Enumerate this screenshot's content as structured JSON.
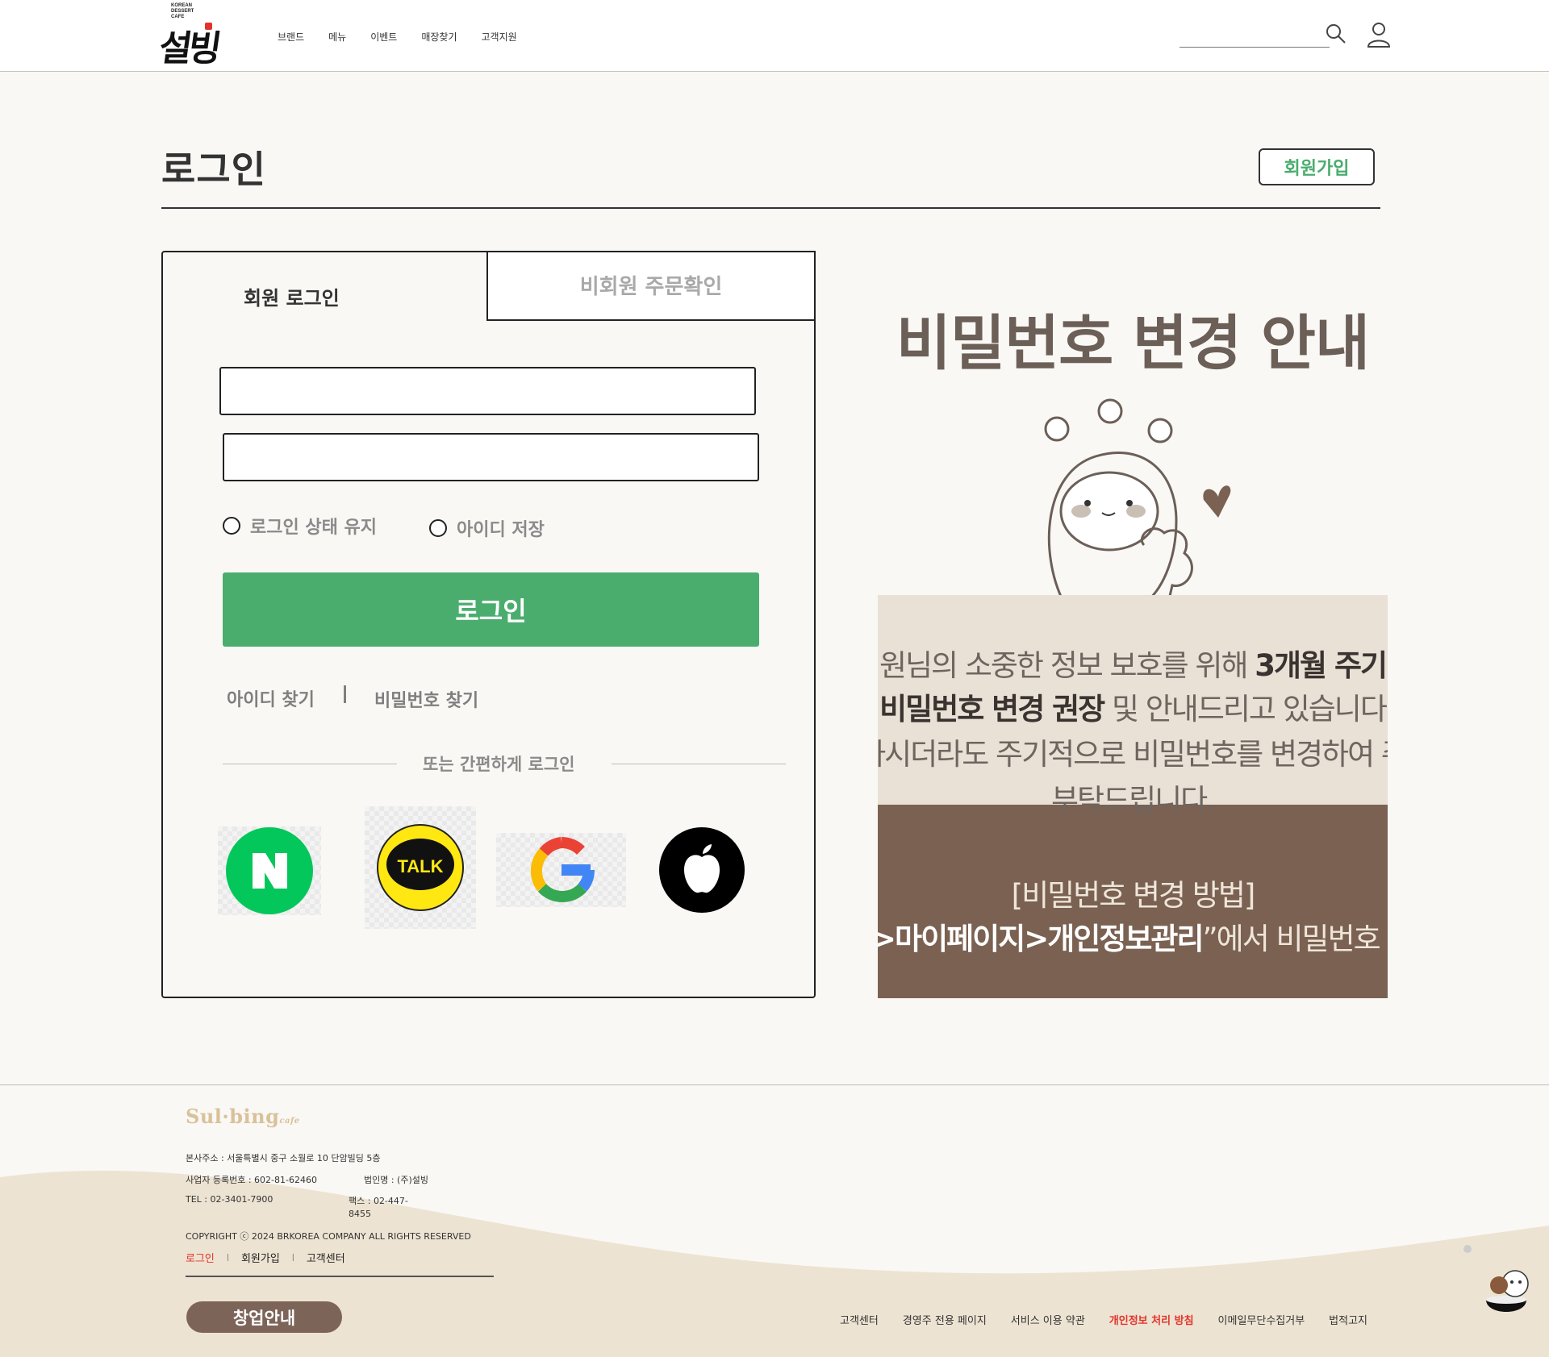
{
  "header": {
    "logo_small": "KOREAN DESSERT CAFE",
    "logo_main": "설빙",
    "nav": [
      "브랜드",
      "메뉴",
      "이벤트",
      "매장찾기",
      "고객지원"
    ],
    "icons": [
      "search-icon",
      "user-icon"
    ]
  },
  "page": {
    "title": "로그인",
    "signup_label": "회원가입"
  },
  "login": {
    "tab_member": "회원 로그인",
    "tab_guest": "비회원 주문확인",
    "id_value": "",
    "pw_value": "",
    "keep_login": "로그인 상태 유지",
    "save_id": "아이디 저장",
    "login_button": "로그인",
    "find_id": "아이디 찾기",
    "find_pw": "비밀번호 찾기",
    "or_text": "또는 간편하게 로그인",
    "social": [
      {
        "name": "naver",
        "glyph": "N",
        "color": "#03c75a"
      },
      {
        "name": "kakao",
        "glyph": "TALK",
        "color": "#ffe812"
      },
      {
        "name": "google",
        "glyph": "G",
        "color": "#4285f4"
      },
      {
        "name": "apple",
        "glyph": "apple-icon",
        "color": "#000000"
      }
    ]
  },
  "notice": {
    "title": "비밀번호 변경 안내",
    "line1_pre": "원님의 소중한 정보 보호를 위해 ",
    "line1_bold": "3개월 주기",
    "line2_bold": "비밀번호 변경 권장",
    "line2_post": " 및 안내드리고 있습니다",
    "line3": "하시더라도 주기적으로 비밀번호를 변경하여 주",
    "line4": "부탁드립니다.",
    "method_title": "[비밀번호 변경 방법]",
    "method_bold": "인>마이페이지>개인정보관리",
    "method_post": "”에서 비밀번호 변경"
  },
  "footer": {
    "logo": "Sul·bing",
    "logo_sub": "cafe",
    "address": "본사주소 : 서울특별시 중구 소월로 10 단암빌딩 5층",
    "biz_no": "사업자 등록번호 : 602-81-62460",
    "corp": "법인명 : (주)설빙",
    "tel": "TEL : 02-3401-7900",
    "fax_line1": "팩스 : 02-447-",
    "fax_line2": "8455",
    "copyright": "COPYRIGHT ⓒ 2024 BRKOREA COMPANY ALL RIGHTS RESERVED",
    "links": [
      "로그인",
      "회원가입",
      "고객센터"
    ],
    "startup": "창업안내",
    "bottom_links": [
      "고객센터",
      "경영주 전용 페이지",
      "서비스 이용 약관",
      "개인정보 처리 방침",
      "이메일무단수집거부",
      "법적고지"
    ]
  },
  "colors": {
    "accent_green": "#4aad6e",
    "brown": "#7d6459",
    "beige": "#e9e1d6",
    "red": "#e2332b"
  }
}
